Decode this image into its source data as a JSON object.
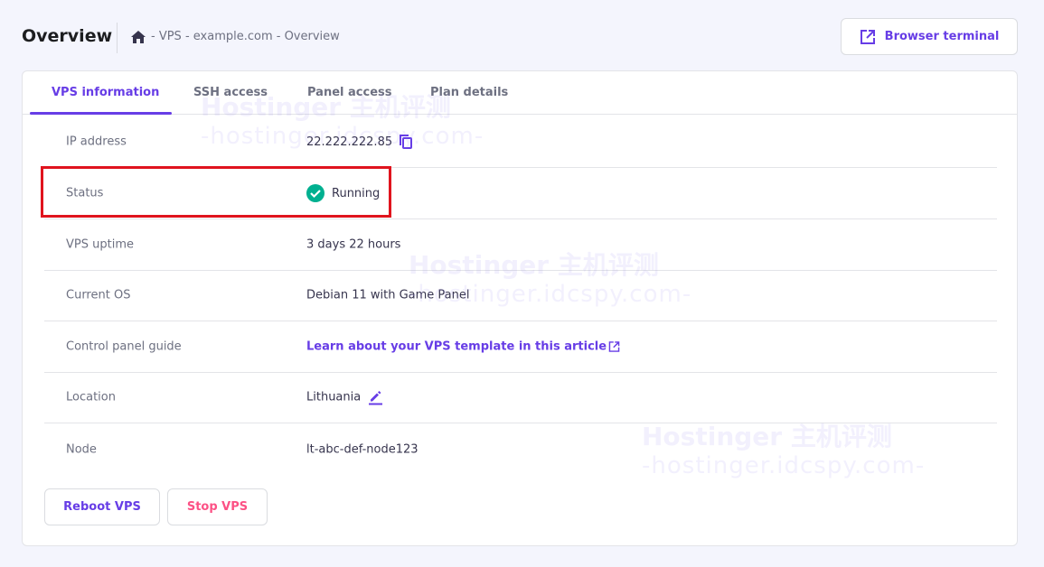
{
  "header": {
    "title": "Overview",
    "breadcrumb": "- VPS - example.com - Overview",
    "browser_terminal": "Browser terminal"
  },
  "tabs": [
    {
      "label": "VPS information",
      "active": true
    },
    {
      "label": "SSH access"
    },
    {
      "label": "Panel access"
    },
    {
      "label": "Plan details"
    }
  ],
  "rows": [
    {
      "label": "IP address",
      "value": "22.222.222.85"
    },
    {
      "label": "Status",
      "value": "Running"
    },
    {
      "label": "VPS uptime",
      "value": "3 days 22 hours"
    },
    {
      "label": "Current OS",
      "value": "Debian 11 with Game Panel"
    },
    {
      "label": "Control panel guide",
      "value": "Learn about your VPS template in this article"
    },
    {
      "label": "Location",
      "value": "Lithuania"
    },
    {
      "label": "Node",
      "value": "lt-abc-def-node123"
    }
  ],
  "buttons": {
    "reboot": "Reboot VPS",
    "stop": "Stop VPS"
  },
  "colors": {
    "accent": "#673de6",
    "running": "#00b090",
    "stop": "#fc5185",
    "highlight": "#e0141e"
  },
  "watermark": {
    "line1": "Hostinger 主机评测",
    "line2": "-hostinger.idcspy.com-"
  }
}
